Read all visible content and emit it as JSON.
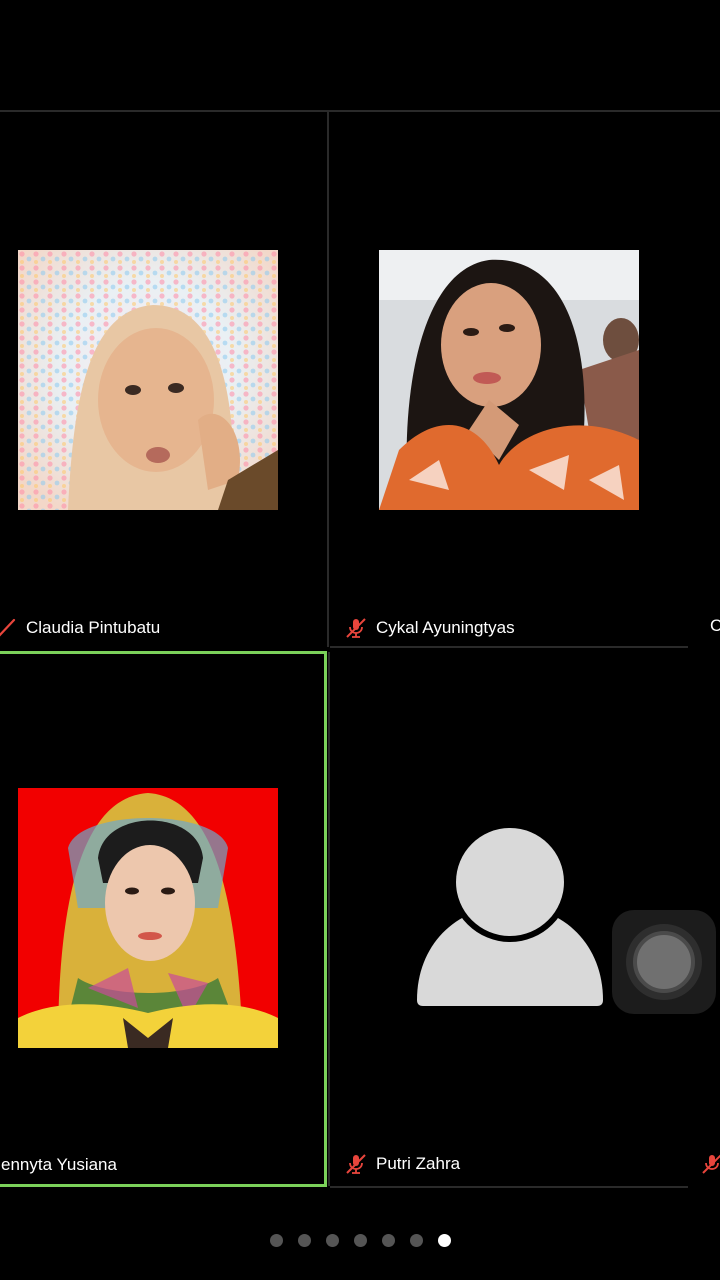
{
  "participants": [
    {
      "name": "Claudia Pintubatu",
      "muted": true
    },
    {
      "name": "Cykal Ayuningtyas",
      "muted": true
    },
    {
      "name": "C"
    },
    {
      "name": "ennyta Yusiana",
      "active_speaker": true
    },
    {
      "name": "Putri Zahra",
      "muted": true,
      "video": false
    }
  ],
  "pagination": {
    "total_pages": 7,
    "current_page": 7
  },
  "colors": {
    "background": "#000000",
    "active_speaker_border": "#7bd15a",
    "muted_icon": "#e8453c",
    "avatar_placeholder": "#d9d9d9"
  },
  "icons": {
    "muted": "mic-muted-icon",
    "no_video": "user-silhouette-icon",
    "floating": "assistive-touch-icon"
  }
}
